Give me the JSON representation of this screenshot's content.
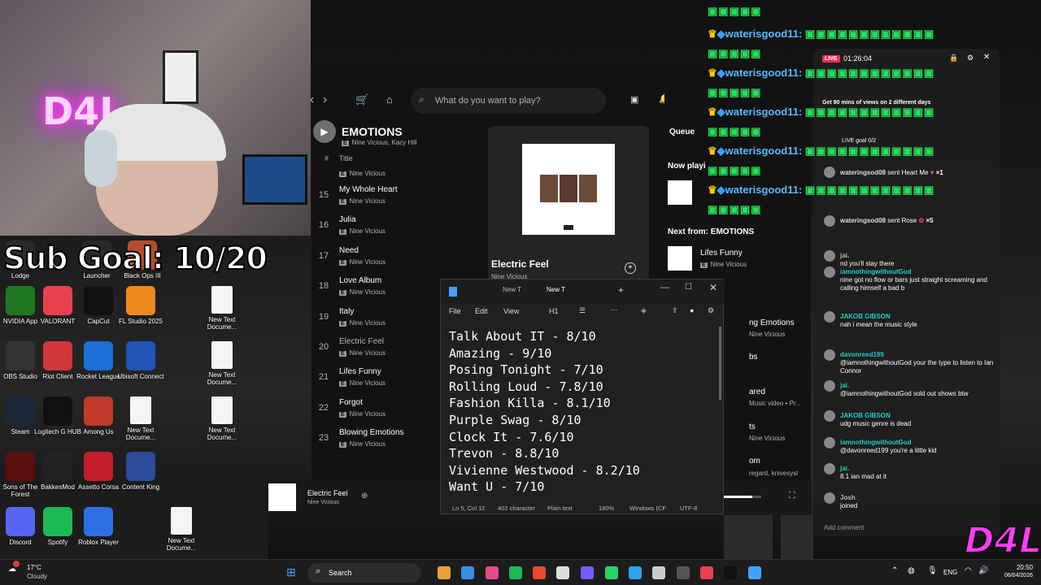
{
  "webcam": {
    "neon_sign": "D4L",
    "sub_goal": "Sub Goal: 10/20"
  },
  "desktop_icons": [
    {
      "label": "Lodge",
      "color": "#2a2a2a"
    },
    {
      "label": "Launcher",
      "color": "#2a2a2a"
    },
    {
      "label": "Black Ops III",
      "color": "#b64c2a"
    },
    {
      "label": "NVIDIA App",
      "color": "#1f7a1f"
    },
    {
      "label": "VALORANT",
      "color": "#e8404f"
    },
    {
      "label": "CapCut",
      "color": "#111111"
    },
    {
      "label": "FL Studio 2025",
      "color": "#f08a1c"
    },
    {
      "label": "New Text Docume...",
      "color": "#f5f5f5"
    },
    {
      "label": "OBS Studio",
      "color": "#333333"
    },
    {
      "label": "Riot Client",
      "color": "#d1363a"
    },
    {
      "label": "Rocket League",
      "color": "#1b6fd6"
    },
    {
      "label": "Ubisoft Connect",
      "color": "#2253b8"
    },
    {
      "label": "New Text Docume...",
      "color": "#f5f5f5"
    },
    {
      "label": "Steam",
      "color": "#1b2838"
    },
    {
      "label": "Logitech G HUB",
      "color": "#111111"
    },
    {
      "label": "Among Us",
      "color": "#c0392b"
    },
    {
      "label": "New Text Docume...",
      "color": "#f5f5f5"
    },
    {
      "label": "New Text Docume...",
      "color": "#f5f5f5"
    },
    {
      "label": "Sons of The Forest",
      "color": "#5a1010"
    },
    {
      "label": "BakkesMod",
      "color": "#222222"
    },
    {
      "label": "Assetto Corsa",
      "color": "#c21d2b"
    },
    {
      "label": "Content King",
      "color": "#2d4b9a"
    },
    {
      "label": "Discord",
      "color": "#5865f2"
    },
    {
      "label": "Spotify",
      "color": "#1db954"
    },
    {
      "label": "Roblox Player",
      "color": "#2f6fe4"
    },
    {
      "label": "New Text Docume...",
      "color": "#f5f5f5"
    }
  ],
  "spotify": {
    "search_placeholder": "What do you want to play?",
    "album_title": "EMOTIONS",
    "album_artists": "Nine Vicious, Kacy Hill",
    "col_title": "Title",
    "col_num": "#",
    "first_artist": "Nine Vicious",
    "tracks": [
      {
        "num": "15",
        "title": "My Whole Heart",
        "artist": "Nine Vicious",
        "playing": false
      },
      {
        "num": "16",
        "title": "Julia",
        "artist": "Nine Vicious",
        "playing": false
      },
      {
        "num": "17",
        "title": "Need",
        "artist": "Nine Vicious",
        "playing": false
      },
      {
        "num": "18",
        "title": "Love Album",
        "artist": "Nine Vicious",
        "playing": false
      },
      {
        "num": "19",
        "title": "Italy",
        "artist": "Nine Vicious",
        "playing": false
      },
      {
        "num": "20",
        "title": "Electric Feel",
        "artist": "Nine Vicious",
        "playing": true
      },
      {
        "num": "21",
        "title": "Lifes Funny",
        "artist": "Nine Vicious",
        "playing": false
      },
      {
        "num": "22",
        "title": "Forgot",
        "artist": "Nine Vicious",
        "playing": false
      },
      {
        "num": "23",
        "title": "Blowing Emotions",
        "artist": "Nine Vicious",
        "playing": false
      }
    ],
    "now_playing_card": {
      "title": "Electric Feel",
      "artist": "Nine Vicious"
    },
    "queue": {
      "tab": "Queue",
      "now_playing_label": "Now playi",
      "next_from": "Next from: EMOTIONS",
      "next_title": "Lifes Funny",
      "next_artist": "Nine Vicious",
      "partial_1": "ng Emotions",
      "partial_1_artist": "Nine Vicious",
      "partial_2": "bs",
      "partial_3": "ared",
      "partial_3_sub": "Music video • Pr...",
      "partial_4": "ts",
      "partial_4_artist": "Nine Vicious",
      "partial_5": "om",
      "partial_5_sub": "regard, knivesysl"
    },
    "bottom_bar": {
      "title": "Electric Feel",
      "artist": "Nine Vicious"
    }
  },
  "notepad": {
    "tab1": "New T",
    "tab2": "New T",
    "menu": [
      "File",
      "Edit",
      "View"
    ],
    "heading": "H1",
    "lines": [
      "Talk About IT - 8/10",
      "Amazing - 9/10",
      "Posing Tonight - 7/10",
      "Rolling Loud - 7.8/10",
      "Fashion Killa - 8.1/10",
      "Purple Swag - 8/10",
      "Clock It - 7.6/10",
      "Trevon - 8.8/10",
      "Vivienne Westwood - 8.2/10",
      "Want U - 7/10"
    ],
    "status": {
      "position": "Ln 5, Col 12",
      "chars": "402 character",
      "format": "Plain text",
      "zoom": "180%",
      "eol": "Windows (CF",
      "encoding": "UTF-8"
    }
  },
  "chat": {
    "live_label": "LIVE",
    "timer": "01:26:04",
    "promo": "Get 90 mins of views on 2 different days",
    "live_goal": "LIVE goal 0/2",
    "gifts": [
      {
        "user": "wateringsod08",
        "text": "sent Heart Me",
        "mult": "×1"
      },
      {
        "user": "wateringsod08",
        "text": "sent Rose",
        "mult": "×5"
      }
    ],
    "messages": [
      {
        "user": "jai.",
        "text": "nd you'll stay there"
      },
      {
        "user": "iamnothingwithoutGod",
        "text": "nine got no flow or bars just straight screaming and calling himself a bad b"
      },
      {
        "user": "JAKOB GIBSON",
        "text": "nah i mean the music style"
      },
      {
        "user": "davonreed199",
        "text": "@iamnothingwithoutGod your the type to listen to Ian Connor"
      },
      {
        "user": "jai.",
        "text": "@iamnothingwithoutGod sold out shows btw"
      },
      {
        "user": "JAKOB GIBSON",
        "text": "udg music genre is dead"
      },
      {
        "user": "iamnothingwithoutGod",
        "text": "@davonreed199 you're a little kid"
      },
      {
        "user": "jai.",
        "text": "8.1 ian mad at it"
      },
      {
        "user": "Josh",
        "text": "joined"
      }
    ],
    "add_comment": "Add comment"
  },
  "overlay_name": "waterisgood11:",
  "watermark": "D4L",
  "taskbar": {
    "weather_temp": "17°C",
    "weather_desc": "Cloudy",
    "search": "Search",
    "lang": "ENG",
    "time": "20:50",
    "date": "06/04/2026"
  }
}
